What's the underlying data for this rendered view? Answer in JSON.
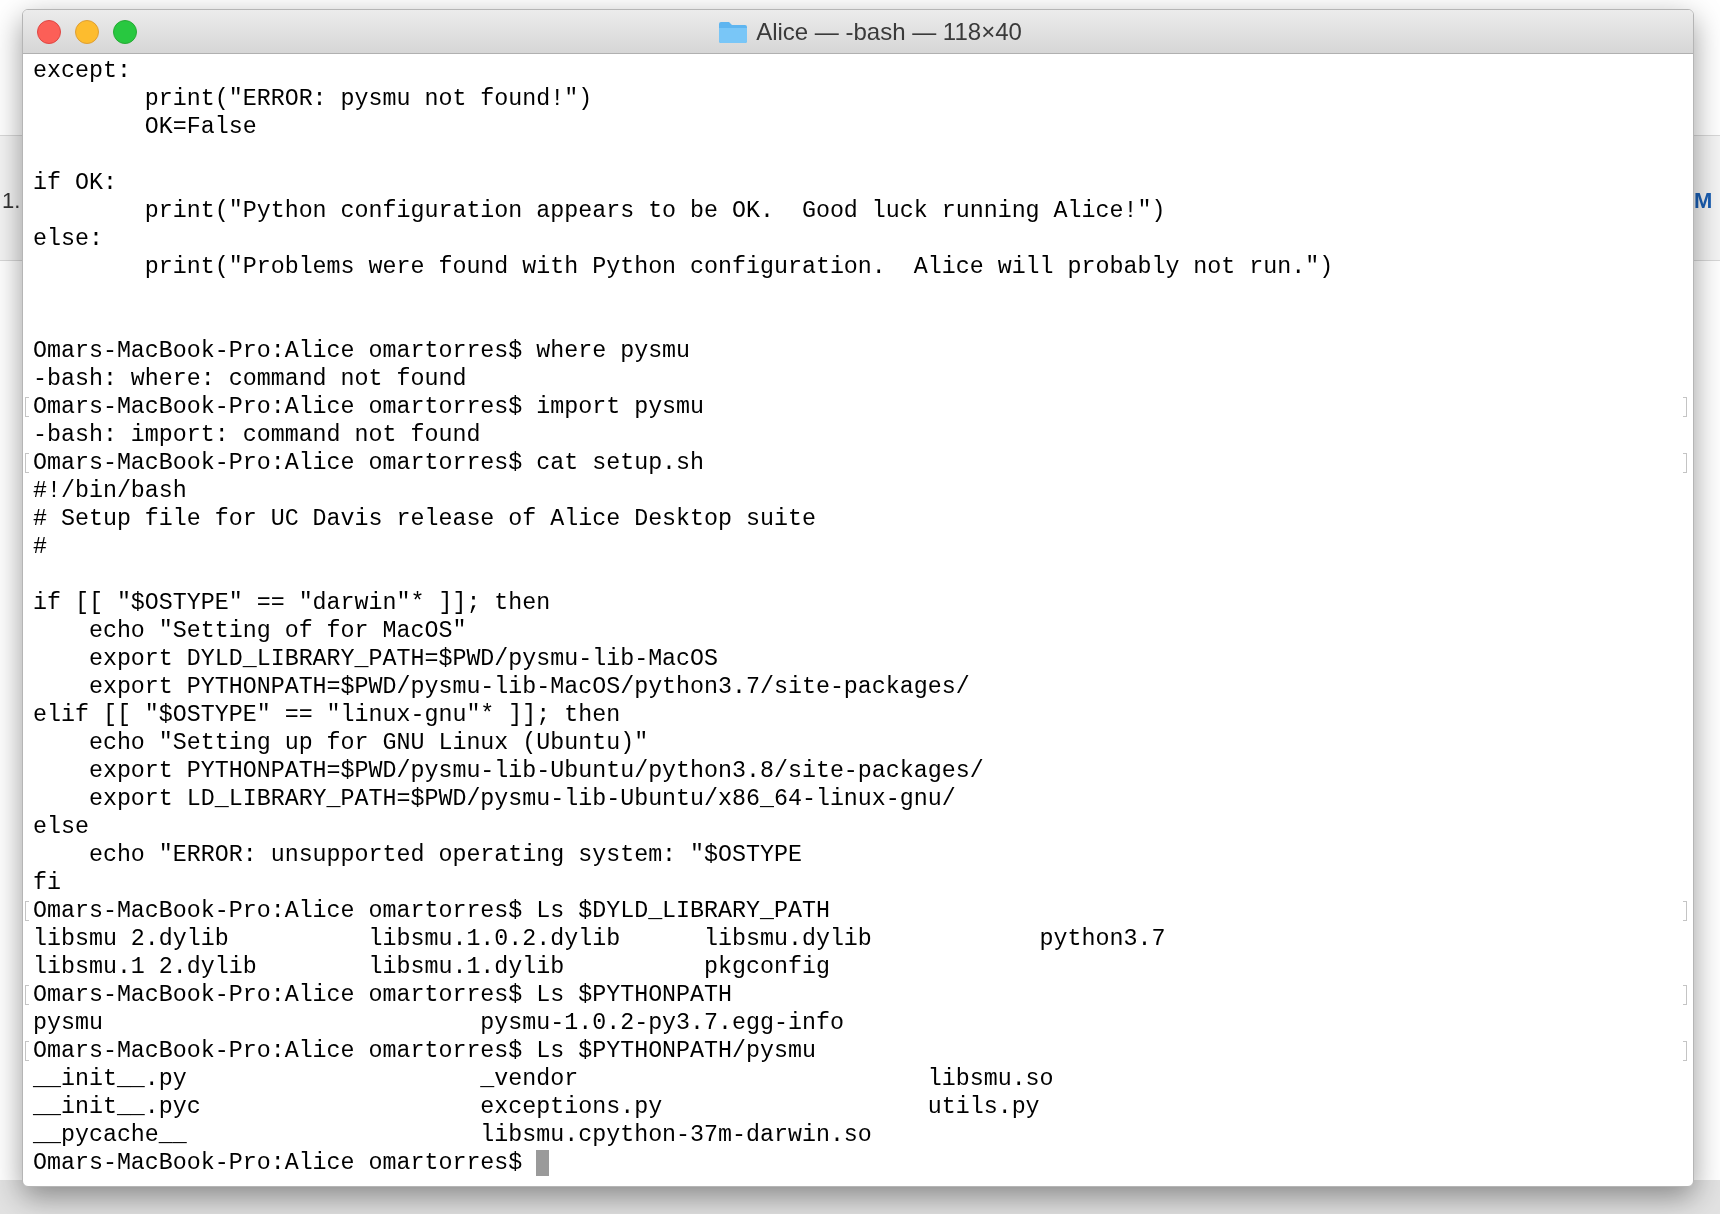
{
  "background_fragments": [
    "1.",
    "M"
  ],
  "window": {
    "title": "Alice — -bash — 118×40"
  },
  "lines": [
    {
      "kind": "text",
      "marked": false,
      "text": "except:"
    },
    {
      "kind": "text",
      "marked": false,
      "text": "        print(\"ERROR: pysmu not found!\")"
    },
    {
      "kind": "text",
      "marked": false,
      "text": "        OK=False"
    },
    {
      "kind": "blank"
    },
    {
      "kind": "text",
      "marked": false,
      "text": "if OK:"
    },
    {
      "kind": "text",
      "marked": false,
      "text": "        print(\"Python configuration appears to be OK.  Good luck running Alice!\")"
    },
    {
      "kind": "text",
      "marked": false,
      "text": "else:"
    },
    {
      "kind": "text",
      "marked": false,
      "text": "        print(\"Problems were found with Python configuration.  Alice will probably not run.\")"
    },
    {
      "kind": "blank"
    },
    {
      "kind": "blank"
    },
    {
      "kind": "text",
      "marked": false,
      "text": "Omars-MacBook-Pro:Alice omartorres$ where pysmu"
    },
    {
      "kind": "text",
      "marked": false,
      "text": "-bash: where: command not found"
    },
    {
      "kind": "text",
      "marked": true,
      "text": "Omars-MacBook-Pro:Alice omartorres$ import pysmu"
    },
    {
      "kind": "text",
      "marked": false,
      "text": "-bash: import: command not found"
    },
    {
      "kind": "text",
      "marked": true,
      "text": "Omars-MacBook-Pro:Alice omartorres$ cat setup.sh"
    },
    {
      "kind": "text",
      "marked": false,
      "text": "#!/bin/bash"
    },
    {
      "kind": "text",
      "marked": false,
      "text": "# Setup file for UC Davis release of Alice Desktop suite"
    },
    {
      "kind": "text",
      "marked": false,
      "text": "#"
    },
    {
      "kind": "blank"
    },
    {
      "kind": "text",
      "marked": false,
      "text": "if [[ \"$OSTYPE\" == \"darwin\"* ]]; then"
    },
    {
      "kind": "text",
      "marked": false,
      "text": "    echo \"Setting of for MacOS\""
    },
    {
      "kind": "text",
      "marked": false,
      "text": "    export DYLD_LIBRARY_PATH=$PWD/pysmu-lib-MacOS"
    },
    {
      "kind": "text",
      "marked": false,
      "text": "    export PYTHONPATH=$PWD/pysmu-lib-MacOS/python3.7/site-packages/"
    },
    {
      "kind": "text",
      "marked": false,
      "text": "elif [[ \"$OSTYPE\" == \"linux-gnu\"* ]]; then"
    },
    {
      "kind": "text",
      "marked": false,
      "text": "    echo \"Setting up for GNU Linux (Ubuntu)\""
    },
    {
      "kind": "text",
      "marked": false,
      "text": "    export PYTHONPATH=$PWD/pysmu-lib-Ubuntu/python3.8/site-packages/"
    },
    {
      "kind": "text",
      "marked": false,
      "text": "    export LD_LIBRARY_PATH=$PWD/pysmu-lib-Ubuntu/x86_64-linux-gnu/"
    },
    {
      "kind": "text",
      "marked": false,
      "text": "else"
    },
    {
      "kind": "text",
      "marked": false,
      "text": "    echo \"ERROR: unsupported operating system: \"$OSTYPE"
    },
    {
      "kind": "text",
      "marked": false,
      "text": "fi"
    },
    {
      "kind": "text",
      "marked": true,
      "text": "Omars-MacBook-Pro:Alice omartorres$ Ls $DYLD_LIBRARY_PATH"
    },
    {
      "kind": "text",
      "marked": false,
      "text": "libsmu 2.dylib          libsmu.1.0.2.dylib      libsmu.dylib            python3.7"
    },
    {
      "kind": "text",
      "marked": false,
      "text": "libsmu.1 2.dylib        libsmu.1.dylib          pkgconfig"
    },
    {
      "kind": "text",
      "marked": true,
      "text": "Omars-MacBook-Pro:Alice omartorres$ Ls $PYTHONPATH"
    },
    {
      "kind": "text",
      "marked": false,
      "text": "pysmu                           pysmu-1.0.2-py3.7.egg-info"
    },
    {
      "kind": "text",
      "marked": true,
      "text": "Omars-MacBook-Pro:Alice omartorres$ Ls $PYTHONPATH/pysmu"
    },
    {
      "kind": "text",
      "marked": false,
      "text": "__init__.py                     _vendor                         libsmu.so"
    },
    {
      "kind": "text",
      "marked": false,
      "text": "__init__.pyc                    exceptions.py                   utils.py"
    },
    {
      "kind": "text",
      "marked": false,
      "text": "__pycache__                     libsmu.cpython-37m-darwin.so"
    },
    {
      "kind": "prompt",
      "marked": false,
      "text": "Omars-MacBook-Pro:Alice omartorres$ "
    }
  ]
}
